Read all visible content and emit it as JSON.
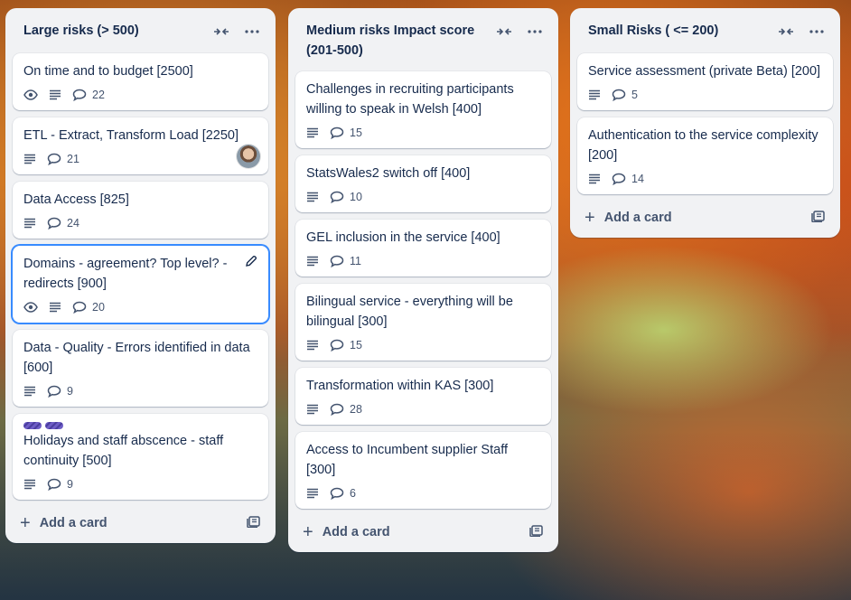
{
  "lists": [
    {
      "title": "Large risks (> 500)",
      "add_card": "Add a card",
      "cards": [
        {
          "title": "On time and to budget [2500]",
          "watch": true,
          "description": true,
          "comments": "22"
        },
        {
          "title": "ETL - Extract, Transform Load [2250]",
          "watch": false,
          "description": true,
          "comments": "21",
          "avatar": true
        },
        {
          "title": "Data Access [825]",
          "watch": false,
          "description": true,
          "comments": "24"
        },
        {
          "title": "Domains - agreement? Top level? - redirects [900]",
          "watch": true,
          "description": true,
          "comments": "20",
          "selected": true
        },
        {
          "title": "Data - Quality - Errors identified in data [600]",
          "watch": false,
          "description": true,
          "comments": "9"
        },
        {
          "title": "Holidays and staff abscence - staff continuity [500]",
          "watch": false,
          "description": true,
          "comments": "9",
          "labels": 2
        }
      ]
    },
    {
      "title": "Medium risks Impact score (201-500)",
      "add_card": "Add a card",
      "cards": [
        {
          "title": "Challenges in recruiting participants willing to speak in Welsh [400]",
          "description": true,
          "comments": "15"
        },
        {
          "title": "StatsWales2 switch off [400]",
          "description": true,
          "comments": "10"
        },
        {
          "title": "GEL inclusion in the service [400]",
          "description": true,
          "comments": "11"
        },
        {
          "title": "Bilingual service - everything will be bilingual [300]",
          "description": true,
          "comments": "15"
        },
        {
          "title": "Transformation within KAS [300]",
          "description": true,
          "comments": "28"
        },
        {
          "title": "Access to Incumbent supplier Staff [300]",
          "description": true,
          "comments": "6"
        }
      ]
    },
    {
      "title": "Small Risks ( <= 200)",
      "add_card": "Add a card",
      "cards": [
        {
          "title": "Service assessment (private Beta) [200]",
          "description": true,
          "comments": "5"
        },
        {
          "title": "Authentication to the service complexity [200]",
          "description": true,
          "comments": "14"
        }
      ]
    }
  ],
  "icons": {
    "collapse": "collapse-icon",
    "more": "more-icon",
    "watch": "eye-icon",
    "description": "description-icon",
    "comments": "comment-icon",
    "template": "card-template-icon",
    "edit": "pencil-icon"
  },
  "colors": {
    "list_bg": "#f1f2f4",
    "card_bg": "#ffffff",
    "selected_border": "#388bff",
    "label": "#6e5dc6"
  }
}
